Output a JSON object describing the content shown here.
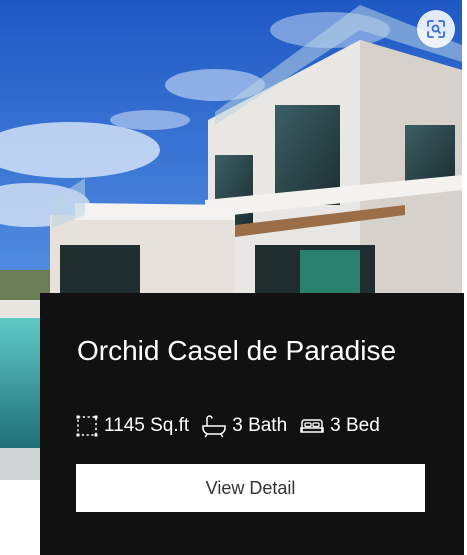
{
  "card": {
    "title": "Orchid Casel de Paradise",
    "features": [
      {
        "icon": "area-icon",
        "text": "1145 Sq.ft"
      },
      {
        "icon": "bathtub-icon",
        "text": "3 Bath"
      },
      {
        "icon": "bed-icon",
        "text": "3 Bed"
      }
    ],
    "button_label": "View Detail",
    "scan_icon": "scan-icon"
  },
  "colors": {
    "panel": "#111111",
    "button_bg": "#ffffff",
    "button_text": "#333333",
    "text": "#ffffff"
  }
}
